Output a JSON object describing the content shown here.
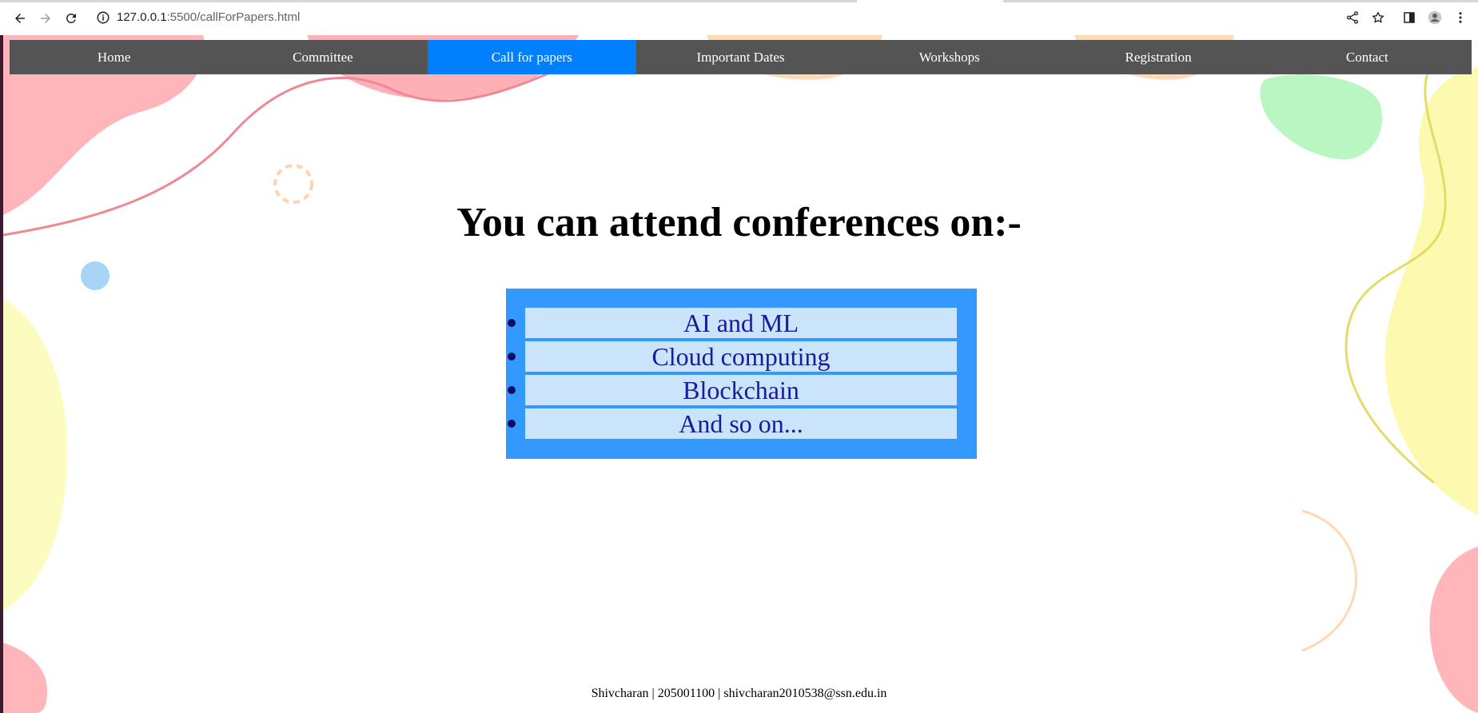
{
  "browser": {
    "url_host": "127.0.0.1",
    "url_path": ":5500/callForPapers.html",
    "icons": {
      "back": "arrow-left-icon",
      "forward": "arrow-right-icon",
      "reload": "reload-icon",
      "site_info": "info-icon",
      "share": "share-icon",
      "bookmark": "star-icon",
      "side_panel": "side-panel-icon",
      "profile": "profile-icon",
      "menu": "kebab-menu-icon"
    }
  },
  "nav": {
    "items": [
      {
        "label": "Home",
        "active": false
      },
      {
        "label": "Committee",
        "active": false
      },
      {
        "label": "Call for papers",
        "active": true
      },
      {
        "label": "Important Dates",
        "active": false
      },
      {
        "label": "Workshops",
        "active": false
      },
      {
        "label": "Registration",
        "active": false
      },
      {
        "label": "Contact",
        "active": false
      }
    ]
  },
  "main": {
    "heading": "You can attend conferences on:-",
    "topics": [
      "AI and ML",
      "Cloud computing",
      "Blockchain",
      "And so on..."
    ]
  },
  "footer": {
    "text": "Shivcharan | 205001100 | shivcharan2010538@ssn.edu.in"
  },
  "colors": {
    "nav_background": "#545454",
    "nav_active": "#0080ff",
    "topic_box": "#3399ff",
    "topic_item": "#c9e4fb",
    "topic_text": "#1a1a9a"
  }
}
